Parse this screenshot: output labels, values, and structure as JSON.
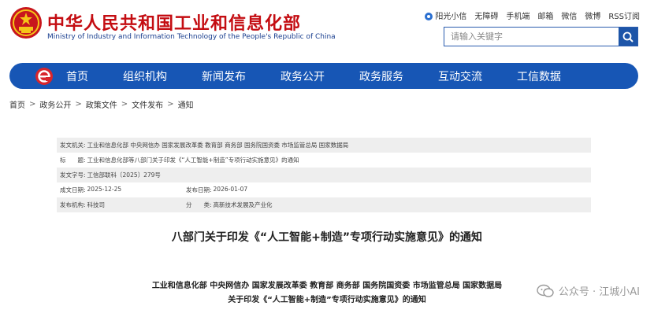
{
  "header": {
    "title_cn": "中华人民共和国工业和信息化部",
    "title_en": "Ministry of Industry and Information Technology of the People's Republic of China",
    "toplinks": [
      "阳光小信",
      "无障碍",
      "手机端",
      "邮箱",
      "微信",
      "微博",
      "RSS订阅"
    ],
    "search_placeholder": "请输入关键字"
  },
  "nav": {
    "items": [
      "首页",
      "组织机构",
      "新闻发布",
      "政务公开",
      "政务服务",
      "互动交流",
      "工信数据"
    ]
  },
  "breadcrumb": [
    "首页",
    "政务公开",
    "政策文件",
    "文件发布",
    "通知"
  ],
  "meta": {
    "issuer_label": "发文机关:",
    "issuer_value": "工业和信息化部 中央网信办 国家发展改革委 教育部 商务部 国务院国资委 市场监管总局 国家数据局",
    "subject_label": "标　　题:",
    "subject_value": "工业和信息化部等八部门关于印发《“人工智能+制造”专项行动实施意见》的通知",
    "number_label": "发文字号:",
    "number_value": "工信部联科〔2025〕279号",
    "date_label": "成文日期:",
    "date_value": "2025-12-25",
    "publish_label": "发布日期:",
    "publish_value": "2026-01-07",
    "org_label": "发布机构:",
    "org_value": "科技司",
    "category_label": "分　　类:",
    "category_value": "高新技术发展及产业化"
  },
  "document": {
    "title": "八部门关于印发《“人工智能+制造”专项行动实施意见》的通知",
    "issuers": "工业和信息化部 中央网信办 国家发展改革委 教育部 商务部 国务院国资委 市场监管总局 国家数据局",
    "subline": "关于印发《“人工智能+制造”专项行动实施意见》的通知"
  },
  "watermark": "公众号 · 江城小AI",
  "colors": {
    "brand_red": "#c40d12",
    "nav_blue": "#1756b5",
    "meta_shade": "#eeeeee"
  }
}
